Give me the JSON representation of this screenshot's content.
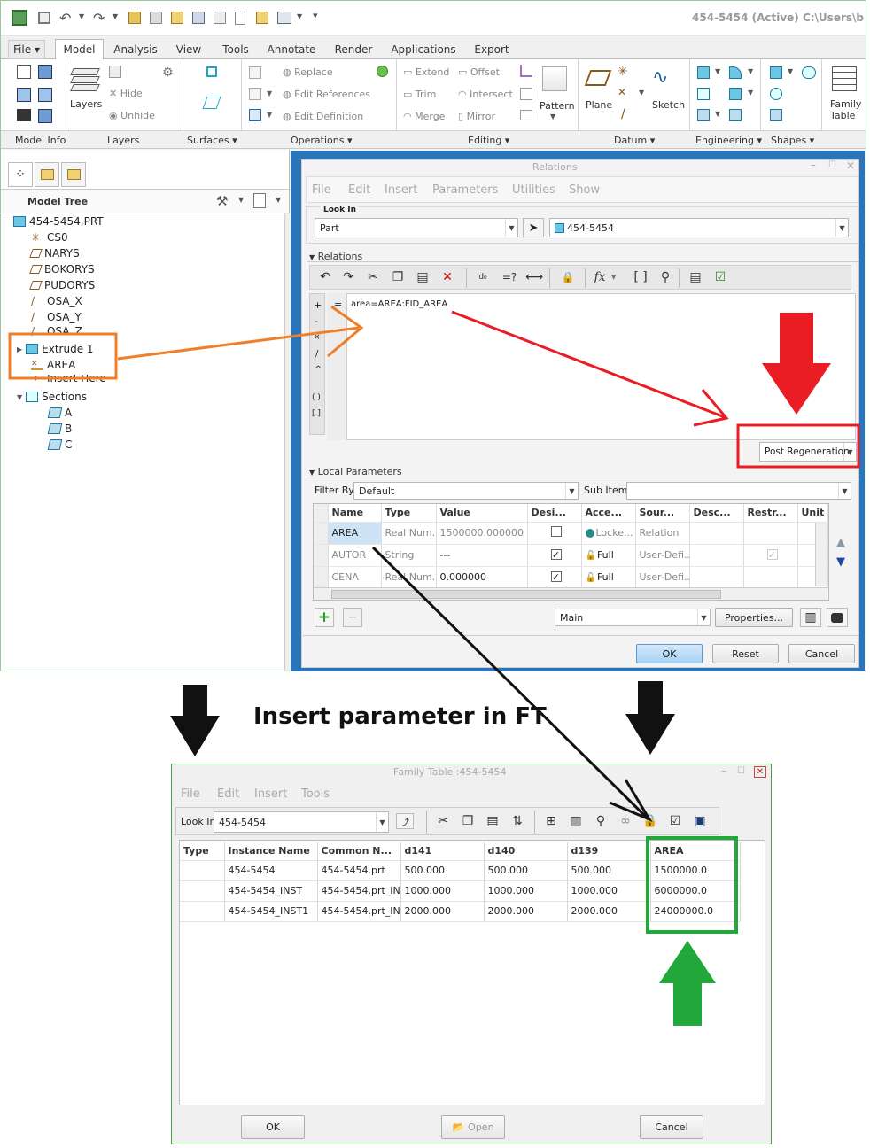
{
  "window_title": "454-5454 (Active) C:\\Users\\b",
  "menu_tabs": [
    "File",
    "Model",
    "Analysis",
    "View",
    "Tools",
    "Annotate",
    "Render",
    "Applications",
    "Export"
  ],
  "ribbon": {
    "layers": "Layers",
    "hide": "Hide",
    "unhide": "Unhide",
    "replace": "Replace",
    "edit_references": "Edit References",
    "edit_definition": "Edit Definition",
    "extend": "Extend",
    "offset": "Offset",
    "trim": "Trim",
    "intersect": "Intersect",
    "merge": "Merge",
    "mirror": "Mirror",
    "pattern": "Pattern",
    "plane": "Plane",
    "sketch": "Sketch",
    "family_table": "Family Table"
  },
  "group_labels": [
    "Model Info",
    "Layers",
    "Surfaces",
    "Operations",
    "Editing",
    "Datum",
    "Engineering",
    "Shapes"
  ],
  "model_tree": {
    "title": "Model Tree",
    "items": [
      "454-5454.PRT",
      "CS0",
      "NARYS",
      "BOKORYS",
      "PUDORYS",
      "OSA_X",
      "OSA_Y",
      "OSA_Z",
      "Extrude 1",
      "AREA",
      "Insert Here",
      "Sections",
      "A",
      "B",
      "C"
    ]
  },
  "relations": {
    "title": "Relations",
    "menu": [
      "File",
      "Edit",
      "Insert",
      "Parameters",
      "Utilities",
      "Show"
    ],
    "look_in_label": "Look In",
    "look_in_type": "Part",
    "look_in_model": "454-5454",
    "relations_header": "Relations",
    "relation_text": "area=AREA:FID_AREA",
    "operators": [
      "+",
      "-",
      "×",
      "/",
      "^",
      "( )",
      "[ ]"
    ],
    "equals": "=",
    "post_regen": "Post Regeneration",
    "local_params_header": "Local Parameters",
    "filter_by_label": "Filter By",
    "filter_by_value": "Default",
    "sub_items_label": "Sub Items",
    "columns": [
      "Name",
      "Type",
      "Value",
      "Desi...",
      "Acce...",
      "Sour...",
      "Desc...",
      "Restr...",
      "Unit"
    ],
    "rows": [
      {
        "name": "AREA",
        "type": "Real Num...",
        "value": "1500000.000000",
        "desig": false,
        "access": "Locke...",
        "source": "Relation",
        "desc": "",
        "restr": ""
      },
      {
        "name": "AUTOR",
        "type": "String",
        "value": "---",
        "desig": true,
        "access": "Full",
        "source": "User-Defi...",
        "desc": "",
        "restr": "checked"
      },
      {
        "name": "CENA",
        "type": "Real Num...",
        "value": "0.000000",
        "desig": true,
        "access": "Full",
        "source": "User-Defi...",
        "desc": "",
        "restr": ""
      }
    ],
    "main_select": "Main",
    "properties_btn": "Properties...",
    "ok": "OK",
    "reset": "Reset",
    "cancel": "Cancel"
  },
  "caption": "Insert parameter in FT",
  "family_table": {
    "title": "Family Table :454-5454",
    "menu": [
      "File",
      "Edit",
      "Insert",
      "Tools"
    ],
    "look_in_label": "Look In:",
    "look_in_value": "454-5454",
    "columns": [
      "Type",
      "Instance Name",
      "Common N...",
      "d141",
      "d140",
      "d139",
      "AREA"
    ],
    "rows": [
      [
        "",
        "454-5454",
        "454-5454.prt",
        "500.000",
        "500.000",
        "500.000",
        "1500000.0"
      ],
      [
        "",
        "454-5454_INST",
        "454-5454.prt_IN...",
        "1000.000",
        "1000.000",
        "1000.000",
        "6000000.0"
      ],
      [
        "",
        "454-5454_INST1",
        "454-5454.prt_IN...",
        "2000.000",
        "2000.000",
        "2000.000",
        "24000000.0"
      ]
    ],
    "ok": "OK",
    "open": "Open",
    "cancel": "Cancel"
  },
  "colors": {
    "orange": "#f07f2a",
    "red": "#ea1c24",
    "green": "#22a83a",
    "black": "#111111",
    "selected_blue": "#2d73b8"
  }
}
